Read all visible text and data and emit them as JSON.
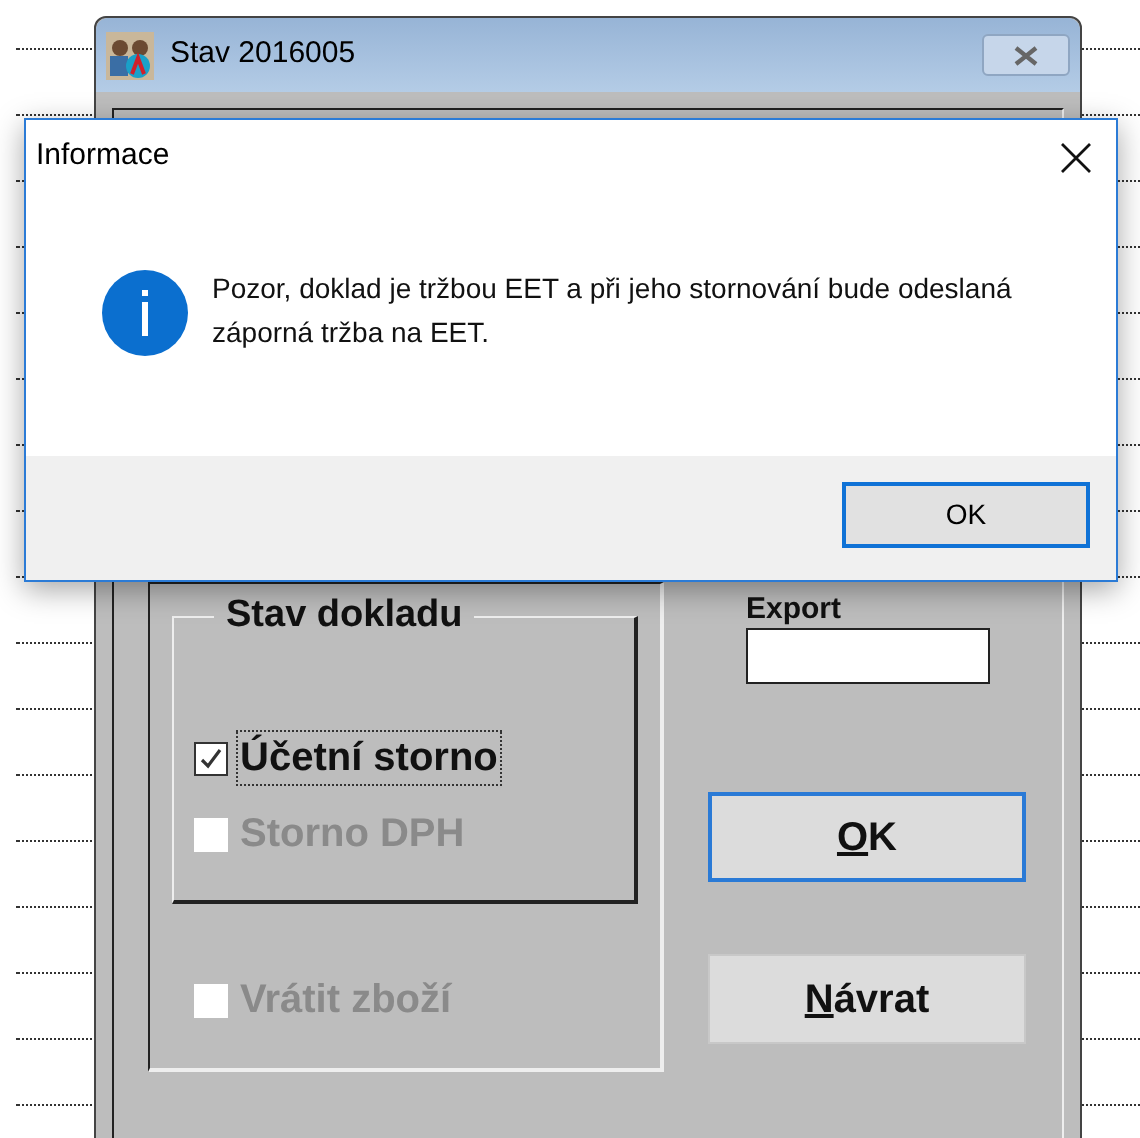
{
  "main_window": {
    "title": "Stav 2016005",
    "group": {
      "title": "Stav dokladu",
      "checkboxes": [
        {
          "label": "Účetní storno",
          "checked": true,
          "disabled": false,
          "focused": true
        },
        {
          "label": "Storno DPH",
          "checked": false,
          "disabled": true,
          "focused": false
        }
      ]
    },
    "extra_checkbox": {
      "label": "Vrátit zboží",
      "checked": false,
      "disabled": true
    },
    "export": {
      "label": "Export"
    },
    "buttons": [
      {
        "label": "OK",
        "default": true
      },
      {
        "label": "Návrat",
        "default": false
      }
    ]
  },
  "dialog": {
    "title": "Informace",
    "message": "Pozor, doklad je tržbou EET a při jeho stornování bude odeslaná záporná tržba na EET.",
    "button": "OK"
  }
}
